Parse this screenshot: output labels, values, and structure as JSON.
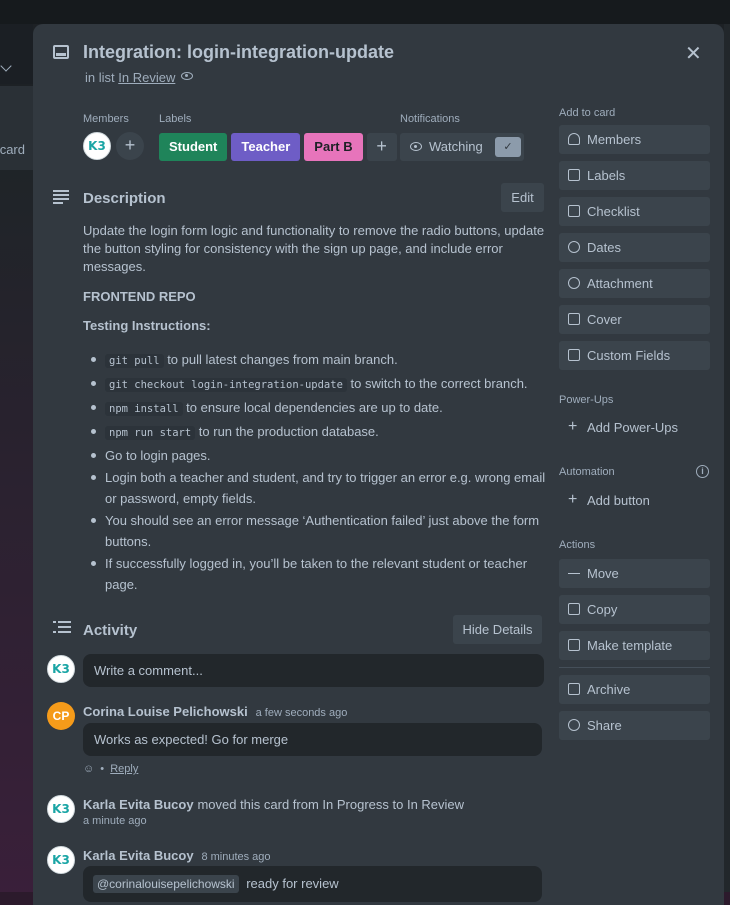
{
  "background": {
    "left_card_text": "card"
  },
  "card": {
    "title": "Integration: login-integration-update",
    "in_list_prefix": "in list",
    "list_name": "In Review",
    "close_symbol": "✕"
  },
  "meta": {
    "members_label": "Members",
    "member_avatar_text": "K3",
    "labels_label": "Labels",
    "labels": [
      {
        "name": "Student",
        "color": "#1f845a",
        "text_color": "#ffffff"
      },
      {
        "name": "Teacher",
        "color": "#6e5dc6",
        "text_color": "#ffffff"
      },
      {
        "name": "Part B",
        "color": "#e774bb",
        "text_color": "#1d2125"
      }
    ],
    "notifications_label": "Notifications",
    "watching_label": "Watching",
    "watching_check": "✓"
  },
  "description": {
    "heading": "Description",
    "edit_label": "Edit",
    "paragraph": "Update the login form logic and functionality to remove the radio buttons, update the button styling for consistency with the sign up page, and include error messages.",
    "repo_heading": "FRONTEND REPO",
    "testing_heading": "Testing Instructions:",
    "items": [
      {
        "code": "git pull",
        "text": " to pull latest changes from main branch."
      },
      {
        "code": "git checkout login-integration-update",
        "text": " to switch to the correct branch."
      },
      {
        "code": "npm install",
        "text": " to ensure local dependencies are up to date."
      },
      {
        "code": "npm run start",
        "text": " to run the production database."
      },
      {
        "code": "",
        "text": "Go to login pages."
      },
      {
        "code": "",
        "text": "Login both a teacher and student, and try to trigger an error e.g. wrong email or password, empty fields."
      },
      {
        "code": "",
        "text": "You should see an error message ‘Authentication failed’ just above the form buttons."
      },
      {
        "code": "",
        "text": "If successfully logged in, you’ll be taken to the relevant student or teacher page."
      }
    ]
  },
  "activity": {
    "heading": "Activity",
    "hide_details_label": "Hide Details",
    "comment_placeholder": "Write a comment...",
    "entries": [
      {
        "avatar_text": "CP",
        "author": "Corina Louise Pelichowski",
        "when": "a few seconds ago",
        "comment": "Works as expected! Go for merge",
        "reaction_icon": "☺",
        "reply_label": "Reply"
      },
      {
        "avatar_text": "K3",
        "author": "Karla Evita Bucoy",
        "action": "moved this card from In Progress to In Review",
        "when": "a minute ago"
      },
      {
        "avatar_text": "K3",
        "author": "Karla Evita Bucoy",
        "when": "8 minutes ago",
        "mention": "@corinalouisepelichowski",
        "comment": "ready for review"
      }
    ]
  },
  "sidebar": {
    "add_to_card_label": "Add to card",
    "add_to_card": [
      "Members",
      "Labels",
      "Checklist",
      "Dates",
      "Attachment",
      "Cover",
      "Custom Fields"
    ],
    "powerups_label": "Power-Ups",
    "add_powerups": "Add Power-Ups",
    "automation_label": "Automation",
    "add_button": "Add button",
    "info_symbol": "i",
    "actions_label": "Actions",
    "actions": [
      "Move",
      "Copy",
      "Make template",
      "Archive",
      "Share"
    ]
  }
}
